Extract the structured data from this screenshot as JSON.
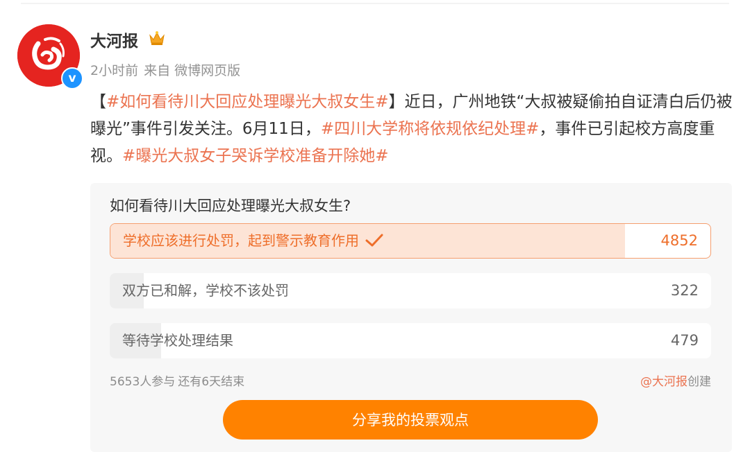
{
  "author": {
    "name": "大河报",
    "avatar_icon": "daheBao-logo-icon",
    "verified_icon": "verified-v-icon",
    "verified_text": "v",
    "crown_icon": "crown-icon"
  },
  "meta": {
    "time": "2小时前",
    "source": "来自 微博网页版"
  },
  "post": {
    "segments": [
      {
        "text": "【",
        "tag": false
      },
      {
        "text": "#如何看待川大回应处理曝光大叔女生#",
        "tag": true
      },
      {
        "text": "】近日，广州地铁“大叔被疑偷拍自证清白后仍被曝光”事件引发关注。6月11日，",
        "tag": false
      },
      {
        "text": "#四川大学称将依规依纪处理#",
        "tag": true
      },
      {
        "text": "，事件已引起校方高度重视。",
        "tag": false
      },
      {
        "text": "#曝光大叔女子哭诉学校准备开除她#",
        "tag": true
      }
    ]
  },
  "poll": {
    "title": "如何看待川大回应处理曝光大叔女生?",
    "options": [
      {
        "label": "学校应该进行处罚，起到警示教育作用",
        "count": "4852",
        "fill_fraction": 0.858,
        "selected": true,
        "check_icon": "checkmark-icon"
      },
      {
        "label": "双方已和解，学校不该处罚",
        "count": "322",
        "fill_fraction": 0.057,
        "selected": false
      },
      {
        "label": "等待学校处理结果",
        "count": "479",
        "fill_fraction": 0.085,
        "selected": false
      }
    ],
    "participants": "5653人参与",
    "remaining": "还有6天结束",
    "creator": "@大河报",
    "created_suffix": "创建",
    "share_button": "分享我的投票观点"
  },
  "colors": {
    "accent": "#ff8200",
    "tag": "#eb7350",
    "selected_fill": "#fde4d6",
    "logo_red": "#e52420",
    "verified_blue": "#1d93ff"
  }
}
